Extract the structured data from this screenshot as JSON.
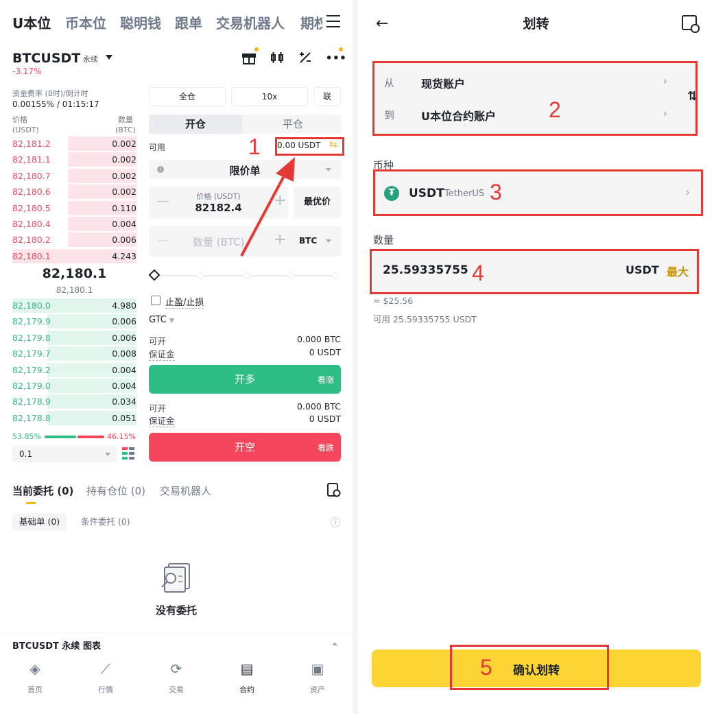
{
  "left": {
    "tabs": [
      "U本位",
      "币本位",
      "聪明钱",
      "跟单",
      "交易机器人",
      "期权"
    ],
    "symbol": "BTCUSDT",
    "contract_type": "永续",
    "change": "-3.17%",
    "funding_label": "资金费率 (8时)/倒计时",
    "funding_value": "0.00155% / 01:15:17",
    "orderbook": {
      "price_header": "价格",
      "price_unit": "(USDT)",
      "qty_header": "数量",
      "qty_unit": "(BTC)",
      "asks": [
        {
          "price": "82,181.2",
          "qty": "0.002",
          "depth": 0.55
        },
        {
          "price": "82,181.1",
          "qty": "0.002",
          "depth": 0.55
        },
        {
          "price": "82,180.7",
          "qty": "0.002",
          "depth": 0.55
        },
        {
          "price": "82,180.6",
          "qty": "0.002",
          "depth": 0.55
        },
        {
          "price": "82,180.5",
          "qty": "0.110",
          "depth": 0.55
        },
        {
          "price": "82,180.4",
          "qty": "0.004",
          "depth": 0.55
        },
        {
          "price": "82,180.2",
          "qty": "0.006",
          "depth": 0.55
        },
        {
          "price": "82,180.1",
          "qty": "4.243",
          "depth": 1.0
        }
      ],
      "last_price": "82,180.1",
      "mark_price": "82,180.1",
      "bids": [
        {
          "price": "82,180.0",
          "qty": "4.980",
          "depth": 1.0
        },
        {
          "price": "82,179.9",
          "qty": "0.006",
          "depth": 0.72
        },
        {
          "price": "82,179.8",
          "qty": "0.006",
          "depth": 0.72
        },
        {
          "price": "82,179.7",
          "qty": "0.008",
          "depth": 0.72
        },
        {
          "price": "82,179.2",
          "qty": "0.004",
          "depth": 0.72
        },
        {
          "price": "82,179.0",
          "qty": "0.004",
          "depth": 0.72
        },
        {
          "price": "82,178.9",
          "qty": "0.034",
          "depth": 0.72
        },
        {
          "price": "82,178.8",
          "qty": "0.051",
          "depth": 0.72
        }
      ],
      "buy_ratio": "53.85%",
      "sell_ratio": "46.15%",
      "precision": "0.1"
    },
    "margin_mode": "全仓",
    "leverage": "10x",
    "mode_extra": "联",
    "open_tab": "开仓",
    "close_tab": "平仓",
    "avail_label": "可用",
    "avail_value": "0.00 USDT",
    "order_type": "限价单",
    "price_label": "价格 (USDT)",
    "price_value": "82182.4",
    "best_price": "最优价",
    "qty_placeholder": "数量 (BTC)",
    "qty_unit": "BTC",
    "tpsl": "止盈/止损",
    "tif": "GTC",
    "long_info": {
      "max_label": "可开",
      "max_value": "0.000 BTC",
      "margin_label": "保证金",
      "margin_value": "0 USDT"
    },
    "long_btn": "开多",
    "long_sub": "看涨",
    "short_info": {
      "max_label": "可开",
      "max_value": "0.000 BTC",
      "margin_label": "保证金",
      "margin_value": "0 USDT"
    },
    "short_btn": "开空",
    "short_sub": "看跌",
    "order_tabs": [
      "当前委托 (0)",
      "持有仓位 (0)",
      "交易机器人"
    ],
    "sub_tabs": [
      "基础单 (0)",
      "条件委托 (0)"
    ],
    "empty_text": "没有委托",
    "chart_bar": "BTCUSDT 永续 图表",
    "nav": [
      "首页",
      "行情",
      "交易",
      "合约",
      "资产"
    ]
  },
  "right": {
    "title": "划转",
    "from_label": "从",
    "from_value": "现货账户",
    "to_label": "到",
    "to_value": "U本位合约账户",
    "coin_label": "币种",
    "coin": "USDT",
    "coin_name": "TetherUS",
    "amount_label": "数量",
    "amount": "25.59335755",
    "amount_unit": "USDT",
    "max": "最大",
    "approx": "≈ $25.56",
    "available": "可用 25.59335755 USDT",
    "confirm": "确认划转"
  },
  "annotations": [
    "1",
    "2",
    "3",
    "4",
    "5"
  ],
  "colors": {
    "red": "#f6465d",
    "green": "#2ebd85",
    "yellow": "#fcd535",
    "annotation": "#e53935"
  }
}
